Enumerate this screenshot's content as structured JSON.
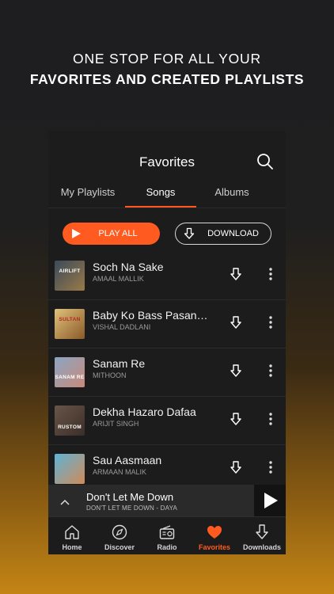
{
  "promo": {
    "line1": "ONE STOP FOR ALL YOUR",
    "line2": "FAVORITES AND CREATED PLAYLISTS"
  },
  "header": {
    "title": "Favorites",
    "search_icon": "search-icon"
  },
  "tabs": [
    {
      "label": "My Playlists",
      "active": false
    },
    {
      "label": "Songs",
      "active": true
    },
    {
      "label": "Albums",
      "active": false
    }
  ],
  "actions": {
    "play_all": "PLAY ALL",
    "download": "DOWNLOAD"
  },
  "songs": [
    {
      "title": "Soch Na Sake",
      "artist": "AMAAL MALLIK",
      "art_text": "AIRLIFT",
      "art_color": "#7a6a4a"
    },
    {
      "title": "Baby Ko Bass Pasan…",
      "artist": "VISHAL DADLANI",
      "art_text": "SULTAN",
      "art_color": "#d8b060"
    },
    {
      "title": "Sanam Re",
      "artist": "MITHOON",
      "art_text": "SANAM RE",
      "art_color": "#6e8aa8"
    },
    {
      "title": "Dekha Hazaro Dafaa",
      "artist": "ARIJIT SINGH",
      "art_text": "RUSTOM",
      "art_color": "#5d4a3e"
    },
    {
      "title": "Sau Aasmaan",
      "artist": "ARMAAN MALIK",
      "art_text": "",
      "art_color": "#c07a55"
    }
  ],
  "mini_player": {
    "title": "Don't Let Me Down",
    "subtitle": "DON'T LET ME DOWN - DAYA"
  },
  "nav": [
    {
      "label": "Home",
      "icon": "home-icon",
      "active": false
    },
    {
      "label": "Discover",
      "icon": "compass-icon",
      "active": false
    },
    {
      "label": "Radio",
      "icon": "radio-icon",
      "active": false
    },
    {
      "label": "Favorites",
      "icon": "heart-icon",
      "active": true
    },
    {
      "label": "Downloads",
      "icon": "download-icon",
      "active": false
    }
  ],
  "colors": {
    "accent": "#ff5a1f",
    "background": "#1c1c1c"
  }
}
